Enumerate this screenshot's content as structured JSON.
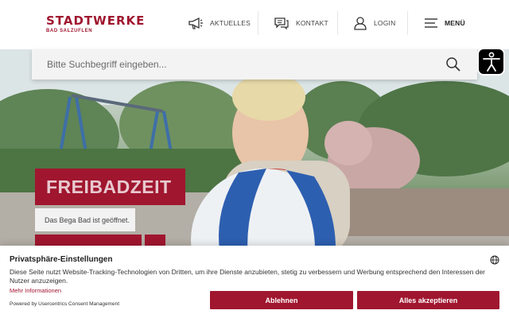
{
  "header": {
    "logo": {
      "name": "STADTWERKE",
      "subline": "BAD SALZUFLEN"
    },
    "nav": [
      {
        "label": "AKTUELLES",
        "icon": "megaphone-icon"
      },
      {
        "label": "KONTAKT",
        "icon": "chat-icon"
      },
      {
        "label": "LOGIN",
        "icon": "user-icon"
      },
      {
        "label": "MENÜ",
        "icon": "hamburger-icon"
      }
    ]
  },
  "search": {
    "placeholder": "Bitte Suchbegriff eingeben..."
  },
  "hero": {
    "headline": "FREIBADZEIT",
    "subline": "Das Bega Bad ist geöffnet."
  },
  "consent": {
    "title": "Privatsphäre-Einstellungen",
    "text": "Diese Seite nutzt Website-Tracking-Technologien von Dritten, um ihre Dienste anzubieten, stetig zu verbessern und Werbung entsprechend den Interessen der Nutzer anzuzeigen.",
    "more_link": "Mehr Informationen",
    "powered_by": "Powered by Usercentrics Consent Management",
    "decline_label": "Ablehnen",
    "accept_label": "Alles akzeptieren"
  },
  "colors": {
    "brand": "#a0162f",
    "surface": "#f3f3f3"
  }
}
